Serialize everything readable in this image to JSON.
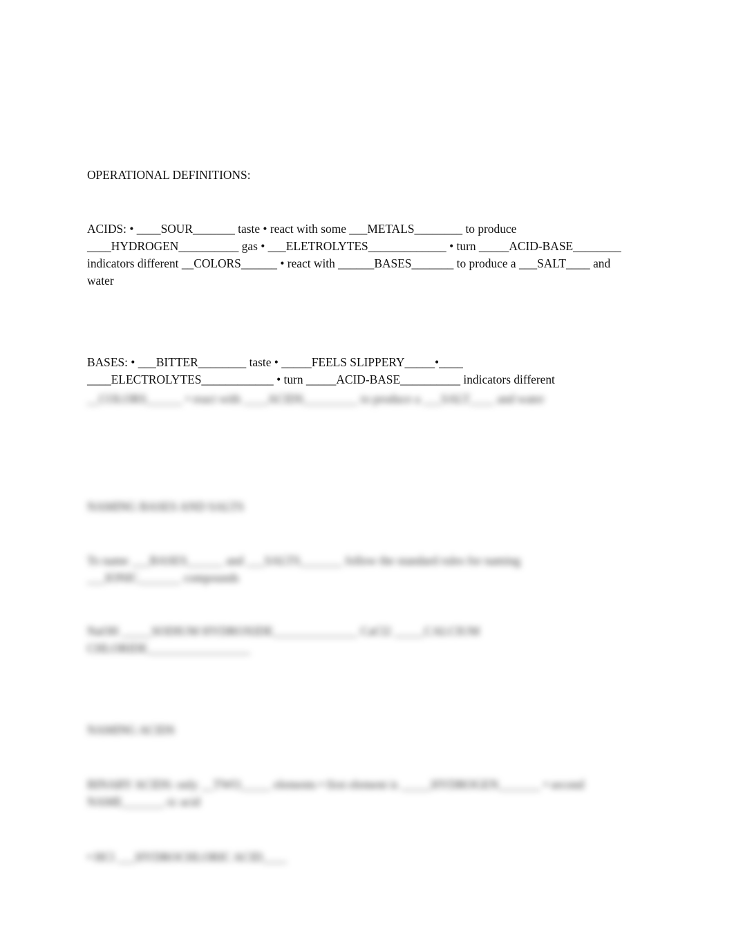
{
  "document": {
    "heading": "OPERATIONAL DEFINITIONS:",
    "acids": {
      "lines": [
        "ACIDS: • ____SOUR_______ taste • react with some ___METALS________ to produce",
        "____HYDROGEN__________ gas • ___ELETROLYTES_____________ • turn _____ACID-BASE________",
        "indicators different __COLORS______ • react with ______BASES_______ to produce a ___SALT____ and",
        "water"
      ]
    },
    "bases": {
      "lines": [
        "BASES: • ___BITTER________ taste • _____FEELS SLIPPERY_____•____",
        "____ELECTROLYTES____________ • turn _____ACID-BASE__________ indicators different"
      ],
      "blurred_line": "__COLORS______ • react with ____ACIDS_________ to produce a ___SALT____ and water"
    },
    "blurred_sections": {
      "title_1": "NAMING BASES AND SALTS",
      "para_1": [
        "To name ___BASES______ and ___SALTS_______ follow the standard rules for naming",
        "___IONIC_______ compounds"
      ],
      "para_2": [
        "NaOH _____SODIUM HYDROXIDE______________ CaCl2 _____CALCIUM",
        "CHLORIDE_________________"
      ],
      "title_2": "NAMING ACIDS",
      "para_3": [
        "BINARY ACIDS: only __TWO_____ elements • first element is _____HYDROGEN_______ • second",
        "NAME_______-ic acid"
      ],
      "para_4": "• HCl ___HYDROCHLORIC ACID____"
    }
  }
}
